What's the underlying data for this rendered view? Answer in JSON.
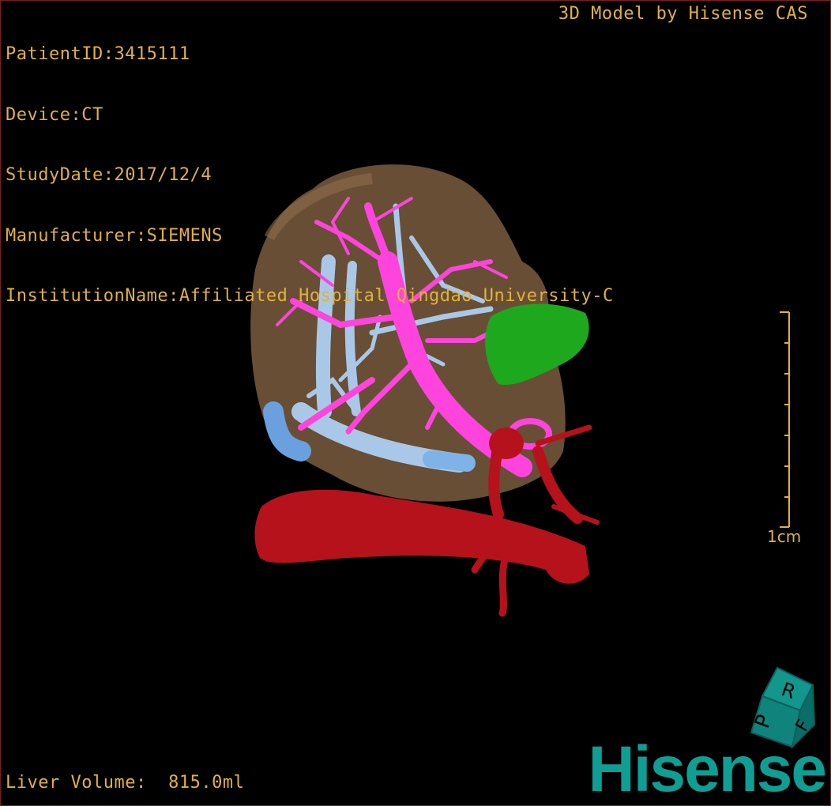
{
  "patient_info": {
    "patient_id": "PatientID:3415111",
    "device": "Device:CT",
    "study_date": "StudyDate:2017/12/4",
    "manufacturer": "Manufacturer:SIEMENS",
    "institution": "InstitutionName:Affiliated Hospital Qingdao University-C"
  },
  "credit": "3D Model by Hisense CAS",
  "liver_volume": "Liver Volume:  815.0ml",
  "scale_label": "1cm",
  "orientation_cube": {
    "faces": [
      "P",
      "R",
      "F"
    ]
  },
  "logo": "Hisense",
  "colors": {
    "overlay_text": "#e0b23c",
    "liver": "#7a5c3e",
    "portal_vein": "#ff44dd",
    "hepatic_vein": "#a9c8e8",
    "artery": "#b5121b",
    "gallbladder": "#1ea81e",
    "brand": "#0e9e94"
  }
}
